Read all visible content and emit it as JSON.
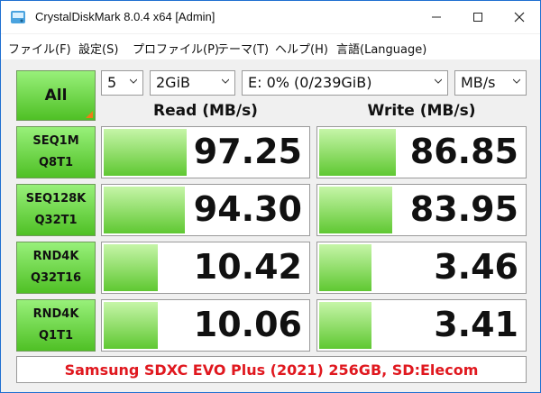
{
  "window": {
    "title": "CrystalDiskMark 8.0.4 x64 [Admin]"
  },
  "menu": [
    "ファイル(F)",
    "設定(S)",
    "プロファイル(P)",
    "テーマ(T)",
    "ヘルプ(H)",
    "言語(Language)"
  ],
  "controls": {
    "all_label": "All",
    "count": "5",
    "size": "2GiB",
    "drive": "E: 0% (0/239GiB)",
    "unit": "MB/s"
  },
  "headers": {
    "read": "Read (MB/s)",
    "write": "Write (MB/s)"
  },
  "rows": [
    {
      "line1": "SEQ1M",
      "line2": "Q8T1",
      "read": "97.25",
      "write": "86.85",
      "read_fill": 0.4,
      "write_fill": 0.37
    },
    {
      "line1": "SEQ128K",
      "line2": "Q32T1",
      "read": "94.30",
      "write": "83.95",
      "read_fill": 0.39,
      "write_fill": 0.35
    },
    {
      "line1": "RND4K",
      "line2": "Q32T16",
      "read": "10.42",
      "write": "3.46",
      "read_fill": 0.26,
      "write_fill": 0.25
    },
    {
      "line1": "RND4K",
      "line2": "Q1T1",
      "read": "10.06",
      "write": "3.41",
      "read_fill": 0.26,
      "write_fill": 0.25
    }
  ],
  "footer": "Samsung SDXC EVO Plus (2021) 256GB, SD:Elecom",
  "colors": {
    "accent_green": "#5fc832",
    "footer_text": "#e0181f",
    "corner_orange": "#f07a18"
  }
}
